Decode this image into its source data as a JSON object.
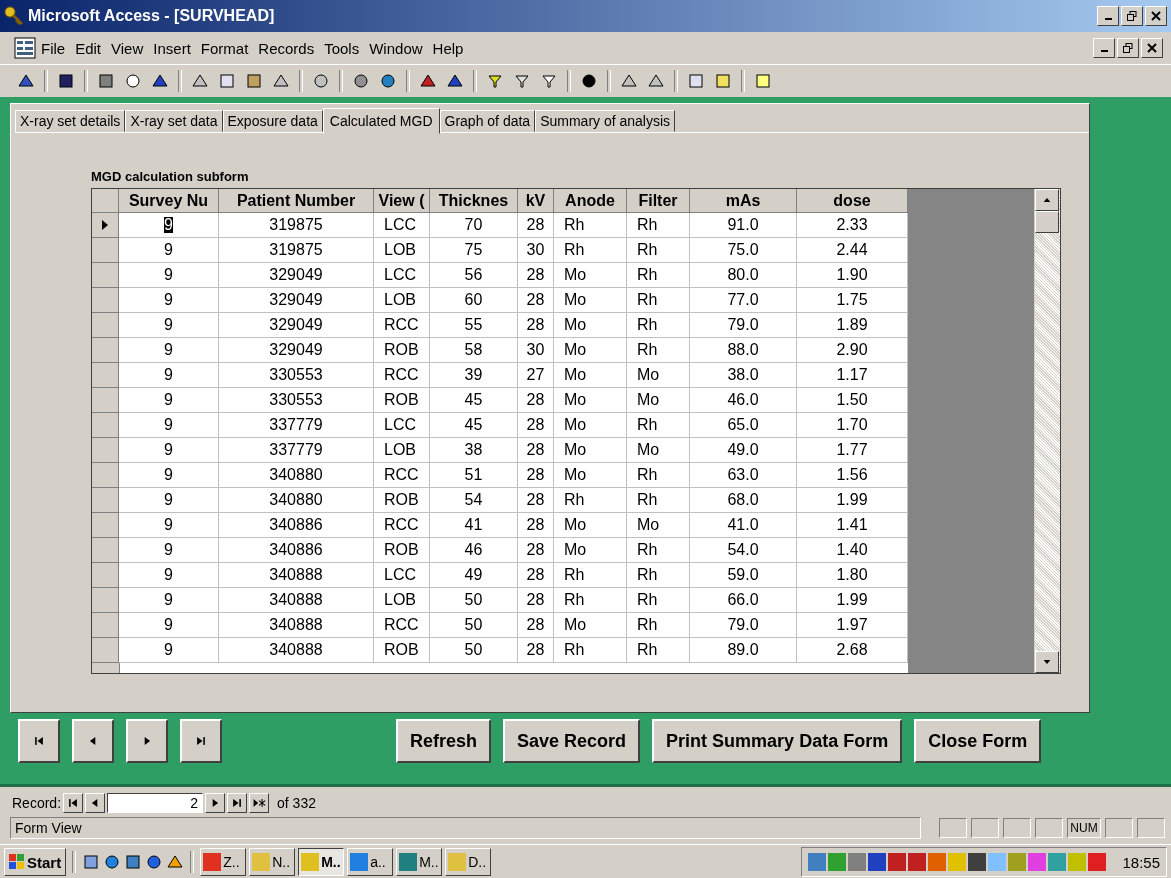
{
  "window": {
    "title": "Microsoft Access - [SURVHEAD]"
  },
  "menu": [
    "File",
    "Edit",
    "View",
    "Insert",
    "Format",
    "Records",
    "Tools",
    "Window",
    "Help"
  ],
  "tabs": [
    {
      "label": "X-ray set details",
      "selected": false
    },
    {
      "label": "X-ray set data",
      "selected": false
    },
    {
      "label": "Exposure data",
      "selected": false
    },
    {
      "label": "Calculated MGD",
      "selected": true
    },
    {
      "label": "Graph of data",
      "selected": false
    },
    {
      "label": "Summary of analysis",
      "selected": false
    }
  ],
  "subform": {
    "label": "MGD calculation subform",
    "columns": [
      "Survey Nu",
      "Patient Number",
      "View (",
      "Thicknes",
      "kV",
      "Anode",
      "Filter",
      "mAs",
      "dose"
    ],
    "rows": [
      {
        "cells": [
          "9",
          "319875",
          "LCC",
          "70",
          "28",
          "Rh",
          "Rh",
          "91.0",
          "2.33"
        ],
        "selected": true
      },
      {
        "cells": [
          "9",
          "319875",
          "LOB",
          "75",
          "30",
          "Rh",
          "Rh",
          "75.0",
          "2.44"
        ],
        "selected": false
      },
      {
        "cells": [
          "9",
          "329049",
          "LCC",
          "56",
          "28",
          "Mo",
          "Rh",
          "80.0",
          "1.90"
        ],
        "selected": false
      },
      {
        "cells": [
          "9",
          "329049",
          "LOB",
          "60",
          "28",
          "Mo",
          "Rh",
          "77.0",
          "1.75"
        ],
        "selected": false
      },
      {
        "cells": [
          "9",
          "329049",
          "RCC",
          "55",
          "28",
          "Mo",
          "Rh",
          "79.0",
          "1.89"
        ],
        "selected": false
      },
      {
        "cells": [
          "9",
          "329049",
          "ROB",
          "58",
          "30",
          "Mo",
          "Rh",
          "88.0",
          "2.90"
        ],
        "selected": false
      },
      {
        "cells": [
          "9",
          "330553",
          "RCC",
          "39",
          "27",
          "Mo",
          "Mo",
          "38.0",
          "1.17"
        ],
        "selected": false
      },
      {
        "cells": [
          "9",
          "330553",
          "ROB",
          "45",
          "28",
          "Mo",
          "Mo",
          "46.0",
          "1.50"
        ],
        "selected": false
      },
      {
        "cells": [
          "9",
          "337779",
          "LCC",
          "45",
          "28",
          "Mo",
          "Rh",
          "65.0",
          "1.70"
        ],
        "selected": false
      },
      {
        "cells": [
          "9",
          "337779",
          "LOB",
          "38",
          "28",
          "Mo",
          "Mo",
          "49.0",
          "1.77"
        ],
        "selected": false
      },
      {
        "cells": [
          "9",
          "340880",
          "RCC",
          "51",
          "28",
          "Mo",
          "Rh",
          "63.0",
          "1.56"
        ],
        "selected": false
      },
      {
        "cells": [
          "9",
          "340880",
          "ROB",
          "54",
          "28",
          "Rh",
          "Rh",
          "68.0",
          "1.99"
        ],
        "selected": false
      },
      {
        "cells": [
          "9",
          "340886",
          "RCC",
          "41",
          "28",
          "Mo",
          "Mo",
          "41.0",
          "1.41"
        ],
        "selected": false
      },
      {
        "cells": [
          "9",
          "340886",
          "ROB",
          "46",
          "28",
          "Mo",
          "Rh",
          "54.0",
          "1.40"
        ],
        "selected": false
      },
      {
        "cells": [
          "9",
          "340888",
          "LCC",
          "49",
          "28",
          "Rh",
          "Rh",
          "59.0",
          "1.80"
        ],
        "selected": false
      },
      {
        "cells": [
          "9",
          "340888",
          "LOB",
          "50",
          "28",
          "Rh",
          "Rh",
          "66.0",
          "1.99"
        ],
        "selected": false
      },
      {
        "cells": [
          "9",
          "340888",
          "RCC",
          "50",
          "28",
          "Mo",
          "Rh",
          "79.0",
          "1.97"
        ],
        "selected": false
      },
      {
        "cells": [
          "9",
          "340888",
          "ROB",
          "50",
          "28",
          "Rh",
          "Rh",
          "89.0",
          "2.68"
        ],
        "selected": false
      }
    ]
  },
  "buttons": [
    "Refresh",
    "Save Record",
    "Print Summary Data Form",
    "Close Form"
  ],
  "record_nav": {
    "label": "Record:",
    "current": "2",
    "total": "of 332"
  },
  "status_bar": {
    "text": "Form View",
    "indicators": [
      "NUM"
    ]
  },
  "taskbar": {
    "start": "Start",
    "tasks": [
      {
        "label": "Z..",
        "selected": false
      },
      {
        "label": "N..",
        "selected": false
      },
      {
        "label": "M..",
        "selected": true
      },
      {
        "label": "a..",
        "selected": false
      },
      {
        "label": "M..",
        "selected": false
      },
      {
        "label": "D..",
        "selected": false
      }
    ],
    "clock": "18:55"
  }
}
